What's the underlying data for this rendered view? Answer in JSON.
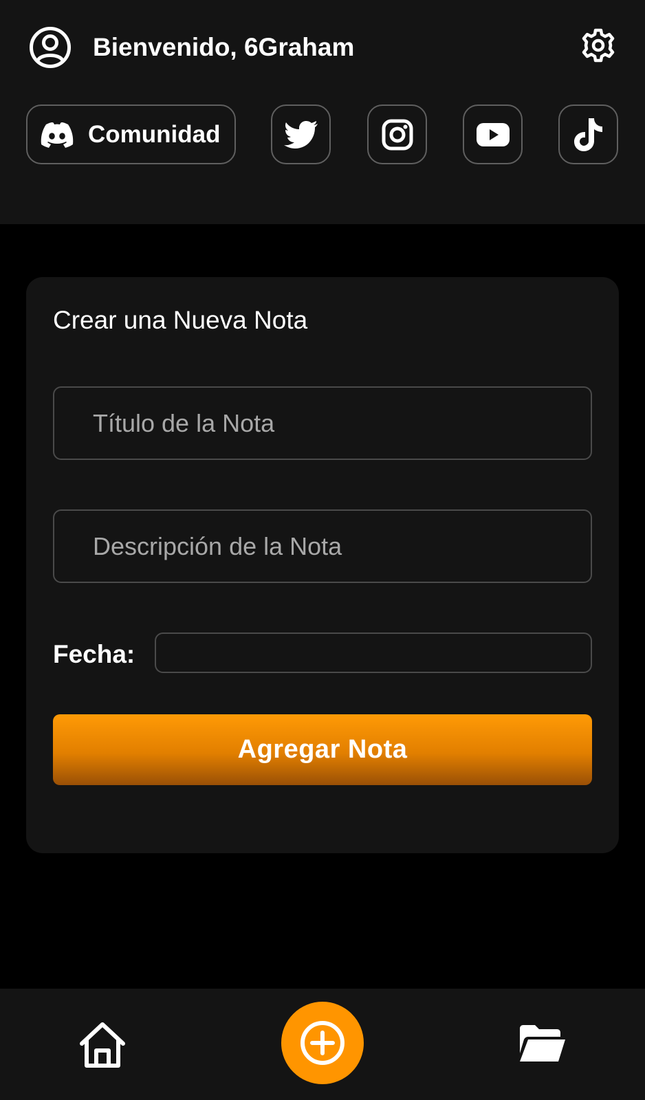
{
  "header": {
    "welcome_text": "Bienvenido, 6Graham",
    "avatar_icon": "user-circle-icon",
    "settings_icon": "gear-icon"
  },
  "social": {
    "community_label": "Comunidad",
    "community_icon": "discord-icon",
    "links": [
      "twitter-icon",
      "instagram-icon",
      "youtube-icon",
      "tiktok-icon"
    ]
  },
  "form": {
    "title": "Crear una Nueva Nota",
    "title_placeholder": "Título de la Nota",
    "description_placeholder": "Descripción de la Nota",
    "date_label": "Fecha:",
    "date_value": "",
    "submit_label": "Agregar Nota"
  },
  "nav": {
    "home_icon": "home-icon",
    "add_icon": "plus-circle-icon",
    "folder_icon": "folder-open-icon"
  },
  "colors": {
    "accent": "#ff9500",
    "header_bg": "#141414",
    "page_bg": "#000000",
    "card_bg": "#141414",
    "border": "#5f5f5f"
  }
}
